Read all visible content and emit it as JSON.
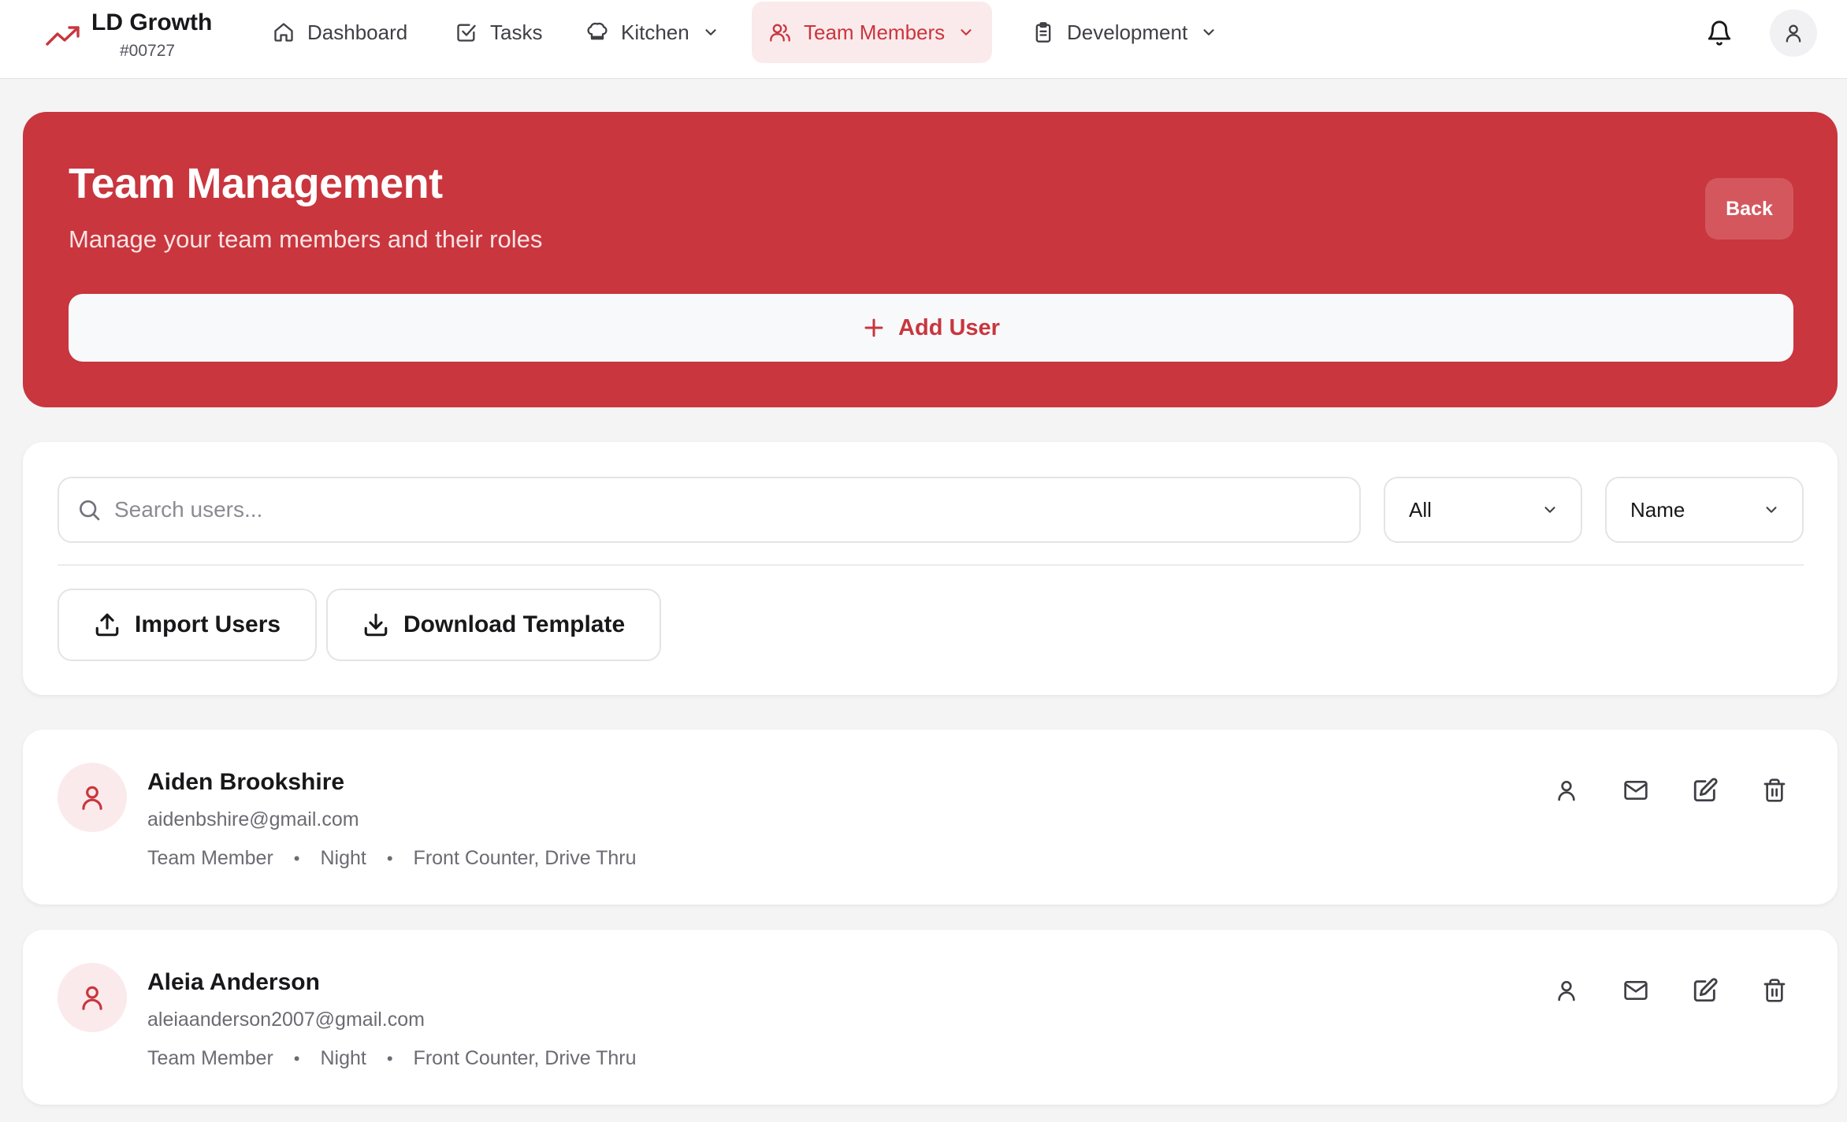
{
  "brand": {
    "name": "LD Growth",
    "code": "#00727",
    "icon": "trending-up-icon"
  },
  "nav": [
    {
      "label": "Dashboard",
      "icon": "home-icon",
      "active": false,
      "dropdown": false
    },
    {
      "label": "Tasks",
      "icon": "checkbox-icon",
      "active": false,
      "dropdown": false
    },
    {
      "label": "Kitchen",
      "icon": "chef-hat-icon",
      "active": false,
      "dropdown": true
    },
    {
      "label": "Team Members",
      "icon": "users-icon",
      "active": true,
      "dropdown": true
    },
    {
      "label": "Development",
      "icon": "clipboard-icon",
      "active": false,
      "dropdown": true
    }
  ],
  "hero": {
    "title": "Team Management",
    "subtitle": "Manage your team members and their roles",
    "back_label": "Back",
    "add_user_label": "Add User"
  },
  "filters": {
    "search_placeholder": "Search users...",
    "role_filter": "All",
    "sort_by": "Name",
    "import_label": "Import Users",
    "download_label": "Download Template"
  },
  "users": [
    {
      "name": "Aiden Brookshire",
      "email": "aidenbshire@gmail.com",
      "role": "Team Member",
      "shift": "Night",
      "stations": "Front Counter, Drive Thru"
    },
    {
      "name": "Aleia Anderson",
      "email": "aleiaanderson2007@gmail.com",
      "role": "Team Member",
      "shift": "Night",
      "stations": "Front Counter, Drive Thru"
    }
  ],
  "colors": {
    "accent": "#c9363e",
    "accent_soft": "#fbeaeb",
    "page_bg": "#f4f4f5"
  }
}
